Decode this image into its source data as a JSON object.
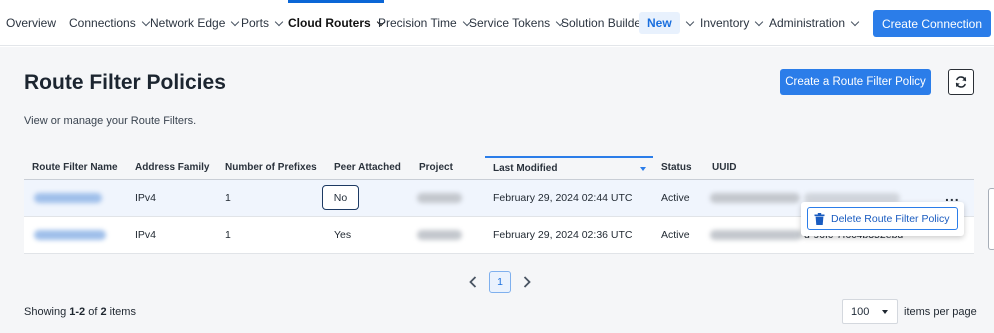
{
  "nav": {
    "items": [
      {
        "label": "Overview",
        "has_menu": false
      },
      {
        "label": "Connections",
        "has_menu": true
      },
      {
        "label": "Network Edge",
        "has_menu": true
      },
      {
        "label": "Ports",
        "has_menu": true
      },
      {
        "label": "Cloud Routers",
        "has_menu": true,
        "active": true
      },
      {
        "label": "Precision Time",
        "has_menu": true
      },
      {
        "label": "Service Tokens",
        "has_menu": true
      },
      {
        "label": "Solution Builder",
        "has_menu": false
      },
      {
        "label": "New",
        "has_menu": true,
        "badge": true
      },
      {
        "label": "Inventory",
        "has_menu": true
      },
      {
        "label": "Administration",
        "has_menu": true
      }
    ],
    "create_connection": "Create Connection"
  },
  "page": {
    "title": "Route Filter Policies",
    "subtitle": "View or manage your Route Filters.",
    "create_button": "Create a Route Filter Policy",
    "refresh_icon": "refresh-icon"
  },
  "table": {
    "columns": [
      "Route Filter Name",
      "Address Family",
      "Number of Prefixes",
      "Peer Attached",
      "Project",
      "Last Modified",
      "Status",
      "UUID"
    ],
    "sorted_column": "Last Modified",
    "sort_direction": "desc",
    "rows": [
      {
        "address_family": "IPv4",
        "prefixes": "1",
        "peer_attached": "No",
        "last_modified": "February 29, 2024 02:44 UTC",
        "status": "Active",
        "uuid_visible": ""
      },
      {
        "address_family": "IPv4",
        "prefixes": "1",
        "peer_attached": "Yes",
        "last_modified": "February 29, 2024 02:36 UTC",
        "status": "Active",
        "uuid_visible": "d-96fc-7f6c4b352ebd"
      }
    ],
    "row_menu": {
      "trigger": "...",
      "items": [
        {
          "label": "Delete Route Filter Policy",
          "icon": "trash-icon"
        }
      ]
    }
  },
  "pagination": {
    "current_page": "1",
    "showing_prefix": "Showing",
    "range": "1-2",
    "of": "of",
    "total": "2",
    "items_word": "items",
    "per_page_value": "100",
    "per_page_label": "items per page"
  },
  "colors": {
    "primary": "#2b7de9",
    "active_nav": "#0a66d6",
    "new_badge_bg": "#e8f1fd"
  }
}
